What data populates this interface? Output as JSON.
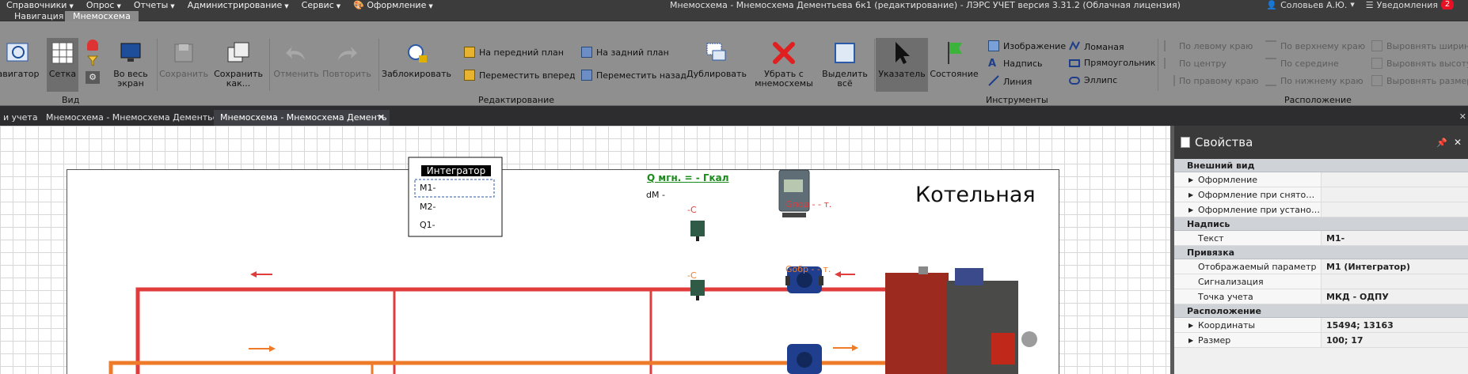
{
  "menu": [
    {
      "label": "Справочники"
    },
    {
      "label": "Опрос"
    },
    {
      "label": "Отчеты"
    },
    {
      "label": "Администрирование"
    },
    {
      "label": "Сервис"
    },
    {
      "label": "Оформление"
    }
  ],
  "window": {
    "title": "Мнемосхема - Мнемосхема Дементьева 6к1 (редактирование) - ЛЭРС УЧЕТ версия 3.31.2 (Облачная лицензия)",
    "user": "Соловьев А.Ю.",
    "notifications_label": "Уведомления",
    "notifications_count": "2"
  },
  "ribbon_tabs": [
    {
      "label": "Навигация"
    },
    {
      "label": "Мнемосхема"
    }
  ],
  "ribbon": {
    "navigator": "авигатор",
    "grid": "Сетка",
    "full_screen": "Во весь экран",
    "group_view": "Вид",
    "save": "Сохранить",
    "save_as": "Сохранить как...",
    "undo": "Отменить",
    "redo": "Повторить",
    "lock": "Заблокировать",
    "bring_front": "На передний план",
    "move_forward": "Переместить вперед",
    "send_back": "На задний план",
    "move_backward": "Переместить назад",
    "duplicate": "Дублировать",
    "remove": "Убрать с мнемосхемы",
    "select_all": "Выделить всё",
    "group_edit": "Редактирование",
    "pointer": "Указатель",
    "state": "Состояние",
    "image": "Изображение",
    "caption": "Надпись",
    "line": "Линия",
    "polyline": "Ломаная",
    "rectangle": "Прямоугольник",
    "ellipse": "Эллипс",
    "group_tools": "Инструменты",
    "align_left": "По левому краю",
    "align_center": "По центру",
    "align_right": "По правому краю",
    "align_top": "По верхнему краю",
    "align_middle": "По середине",
    "align_bottom": "По нижнему краю",
    "equal_width": "Выровнять ширину",
    "equal_height": "Выровнять высоту",
    "equal_size": "Выровнять размер",
    "group_layout": "Расположение"
  },
  "doc_tabs": [
    {
      "label": "и учета"
    },
    {
      "label": "Мнемосхема - Мнемосхема Дементьева"
    },
    {
      "label": "Мнемосхема - Мнемосхема Дементь"
    }
  ],
  "scheme": {
    "integrator_title": "Интегратор",
    "m1": "М1-",
    "m2": "М2-",
    "q1": "Q1-",
    "q_label": "Q мгн. = - Гкал",
    "dm_label": "dM -",
    "temp1": "-C",
    "temp2": "-C",
    "g_supply": "Gпод - - т.",
    "g_return": "Gобр - - т.",
    "boiler_title": "Котельная",
    "supply_color": "#e03c3c",
    "return_color": "#ee7b2a"
  },
  "properties": {
    "title": "Свойства",
    "categories": [
      {
        "name": "Внешний вид",
        "rows": [
          {
            "name": "Оформление",
            "value": "",
            "expandable": true
          },
          {
            "name": "Оформление при снятом сиг...",
            "value": "",
            "expandable": true
          },
          {
            "name": "Оформление при установле...",
            "value": "",
            "expandable": true
          }
        ]
      },
      {
        "name": "Надпись",
        "rows": [
          {
            "name": "Текст",
            "value": "М1-",
            "expandable": false
          }
        ]
      },
      {
        "name": "Привязка",
        "rows": [
          {
            "name": "Отображаемый параметр",
            "value": "М1 (Интегратор)",
            "expandable": false
          },
          {
            "name": "Сигнализация",
            "value": "",
            "expandable": false
          },
          {
            "name": "Точка учета",
            "value": "МКД - ОДПУ",
            "expandable": false
          }
        ]
      },
      {
        "name": "Расположение",
        "rows": [
          {
            "name": "Координаты",
            "value": "15494; 13163",
            "expandable": true
          },
          {
            "name": "Размер",
            "value": "100; 17",
            "expandable": true
          }
        ]
      }
    ]
  }
}
